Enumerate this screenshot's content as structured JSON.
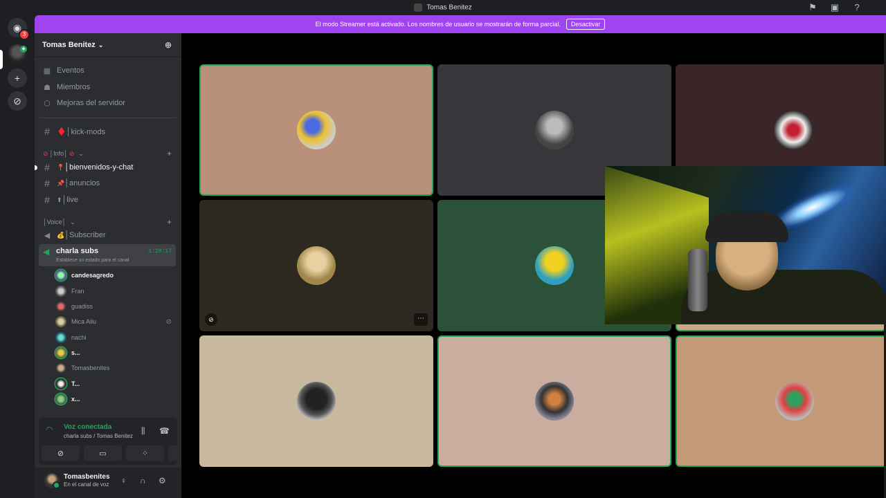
{
  "window": {
    "title": "Tomas Benitez"
  },
  "banner": {
    "text": "El modo Streamer está activado. Los nombres de usuario se mostrarán de forma parcial.",
    "button": "Desactivar",
    "color": "#a044f0"
  },
  "guilds": {
    "home_badge": "3"
  },
  "server": {
    "name": "Tomas Benitez",
    "nav": [
      {
        "label": "Eventos",
        "icon": "calendar-icon"
      },
      {
        "label": "Miembros",
        "icon": "members-icon"
      },
      {
        "label": "Mejoras del servidor",
        "icon": "boost-icon"
      }
    ],
    "channels_top": [
      {
        "label": "♦️│kick-mods"
      }
    ],
    "category_info": "│Info│",
    "info_channels": [
      {
        "label": "│bienvenidos-y-chat",
        "emoji": "📍"
      },
      {
        "label": "│anuncios",
        "emoji": "📌"
      },
      {
        "label": "│live",
        "emoji": "⬆"
      }
    ],
    "category_voice": "│Voice│",
    "voice_channels": [
      {
        "label": "│Subscriber",
        "emoji": "💰"
      }
    ],
    "active_voice": {
      "name": "charla subs",
      "status": "Establece un estado para el canal",
      "time": "1:28:17"
    },
    "members": [
      {
        "name": "candesagredo",
        "bold": true
      },
      {
        "name": "Fran",
        "bold": false
      },
      {
        "name": "guadiss",
        "bold": false
      },
      {
        "name": "Mica Ailu",
        "bold": false,
        "muted": true
      },
      {
        "name": "nachi",
        "bold": false
      },
      {
        "name": "s...",
        "bold": true
      },
      {
        "name": "Tomasbenites",
        "bold": false
      },
      {
        "name": "T...",
        "bold": true
      },
      {
        "name": "x...",
        "bold": true
      }
    ]
  },
  "voice_panel": {
    "title": "Voz conectada",
    "subtitle": "charla subs / Tomas Benitez"
  },
  "user": {
    "name": "Tomasbenites",
    "status": "En el canal de voz"
  },
  "colors": {
    "accent_green": "#23a55a",
    "bg_dark": "#1e1f22",
    "sidebar": "#2b2d31"
  }
}
